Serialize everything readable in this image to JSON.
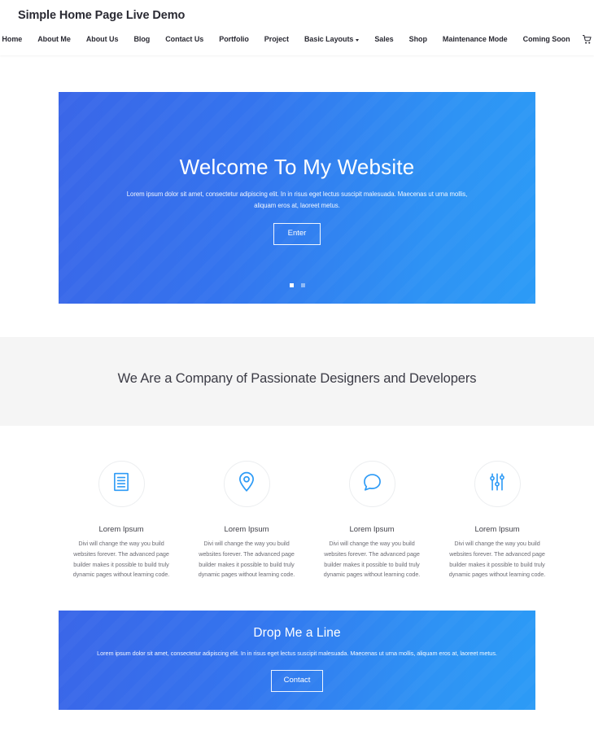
{
  "header": {
    "logo": "Simple Home Page Live Demo",
    "nav": [
      {
        "label": "Home",
        "active": true,
        "caret": false
      },
      {
        "label": "About Me",
        "active": false,
        "caret": false
      },
      {
        "label": "About Us",
        "active": false,
        "caret": false
      },
      {
        "label": "Blog",
        "active": false,
        "caret": false
      },
      {
        "label": "Contact Us",
        "active": false,
        "caret": false
      },
      {
        "label": "Portfolio",
        "active": false,
        "caret": false
      },
      {
        "label": "Project",
        "active": false,
        "caret": false
      },
      {
        "label": "Basic Layouts",
        "active": false,
        "caret": true
      },
      {
        "label": "Sales",
        "active": false,
        "caret": false
      },
      {
        "label": "Shop",
        "active": false,
        "caret": false
      },
      {
        "label": "Maintenance Mode",
        "active": false,
        "caret": false
      },
      {
        "label": "Coming Soon",
        "active": false,
        "caret": false
      }
    ],
    "cart_icon": "shopping-cart-icon"
  },
  "hero": {
    "title": "Welcome To My Website",
    "subtitle": "Lorem ipsum dolor sit amet, consectetur adipiscing elit. In in risus eget lectus suscipit malesuada. Maecenas ut urna mollis, aliquam eros at, laoreet metus.",
    "button_label": "Enter",
    "gradient_from": "#3a66e8",
    "gradient_to": "#2c9bf6",
    "slides": [
      {
        "active": true
      },
      {
        "active": false
      }
    ]
  },
  "band": {
    "title": "We Are a Company of Passionate Designers and Developers",
    "background": "#f5f5f5"
  },
  "features": {
    "accent_color": "#2e9bf6",
    "items": [
      {
        "icon": "document-icon",
        "title": "Lorem Ipsum",
        "text": "Divi will change the way you build websites forever. The advanced page builder makes it possible to build truly dynamic pages without learning code."
      },
      {
        "icon": "map-pin-icon",
        "title": "Lorem Ipsum",
        "text": "Divi will change the way you build websites forever. The advanced page builder makes it possible to build truly dynamic pages without learning code."
      },
      {
        "icon": "speech-bubble-icon",
        "title": "Lorem Ipsum",
        "text": "Divi will change the way you build websites forever. The advanced page builder makes it possible to build truly dynamic pages without learning code."
      },
      {
        "icon": "sliders-icon",
        "title": "Lorem Ipsum",
        "text": "Divi will change the way you build websites forever. The advanced page builder makes it possible to build truly dynamic pages without learning code."
      }
    ]
  },
  "cta": {
    "title": "Drop Me a Line",
    "subtitle": "Lorem ipsum dolor sit amet, consectetur adipiscing elit. In in risus eget lectus suscipit malesuada. Maecenas ut urna mollis, aliquam eros at, laoreet metus.",
    "button_label": "Contact",
    "gradient_from": "#3a66e8",
    "gradient_to": "#2c9bf6"
  }
}
